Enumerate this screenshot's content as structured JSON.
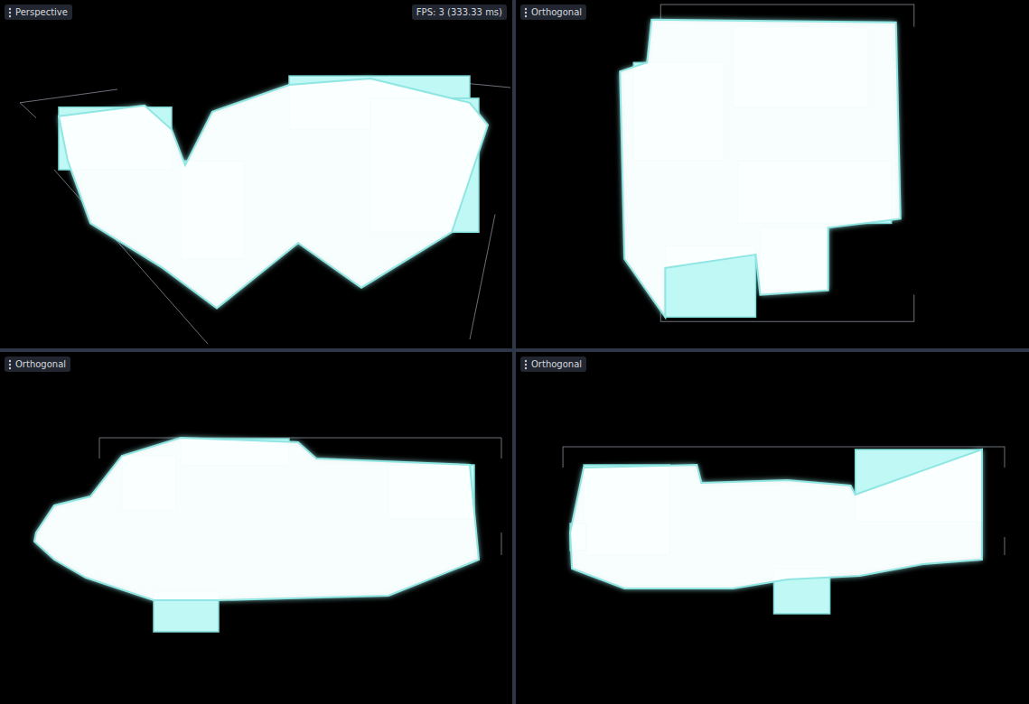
{
  "viewports": [
    {
      "label": "Perspective",
      "kind": "perspective",
      "info": "FPS: 3 (333.33 ms)"
    },
    {
      "label": "Orthogonal",
      "kind": "top",
      "info": ""
    },
    {
      "label": "Orthogonal",
      "kind": "front",
      "info": ""
    },
    {
      "label": "Orthogonal",
      "kind": "side",
      "info": ""
    }
  ]
}
